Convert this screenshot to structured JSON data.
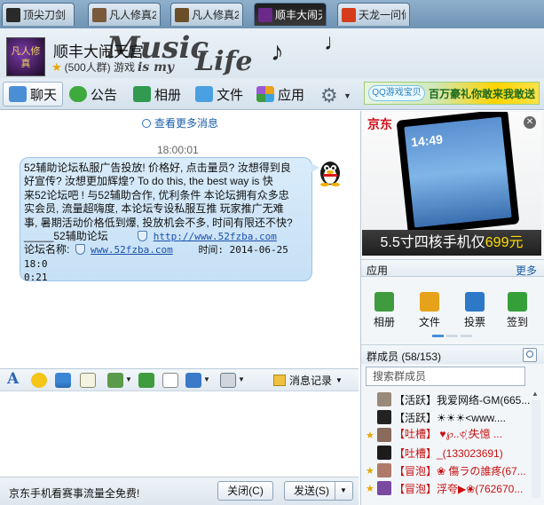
{
  "tabs": [
    {
      "label": "顶尖刀剑",
      "color": "#2a2a2a"
    },
    {
      "label": "凡人修真2",
      "color": "#7a5a3a"
    },
    {
      "label": "凡人修真2",
      "color": "#6b4f2a"
    },
    {
      "label": "顺丰大闹天",
      "color": "#6b2a8a"
    },
    {
      "label": "天龙一问仙",
      "color": "#d43c1c"
    }
  ],
  "header": {
    "avatar_text": "凡人修真",
    "group_name": "顺丰大闹天宫",
    "member_count_text": "(500人群) 游戏",
    "deco_line1": "Music",
    "deco_line2": "is my",
    "deco_line3": "Life"
  },
  "toolbar": {
    "items": [
      {
        "label": "聊天",
        "icon": "chat-icon"
      },
      {
        "label": "公告",
        "icon": "announcement-icon"
      },
      {
        "label": "相册",
        "icon": "album-icon"
      },
      {
        "label": "文件",
        "icon": "file-icon"
      },
      {
        "label": "应用",
        "icon": "apps-icon"
      }
    ],
    "settings_icon": "gear-icon",
    "ad_logo": "QQ游戏宝贝",
    "ad_text": "百万豪礼你敢来我敢送"
  },
  "chat": {
    "more_messages": "查看更多消息",
    "timestamp": "18:00:01",
    "message_lines": [
      "52辅助论坛私服广告投放! 价格好, 点击量员? 汝想得到良",
      "好宣传? 汝想更加辉煌? To do this, the best way is 快",
      "来52论坛吧 ! 与52辅助合作, 优利条件 本论坛拥有众多忠",
      "实会员, 流量超嗨度, 本论坛专设私服互推 玩家推广无难",
      "事, 暑期活动价格低到爆, 投放机会不多, 时间有限还不快?"
    ],
    "forum_prefix": "_____52辅助论坛",
    "forum_link": "http://www.52fzba.com",
    "address_label": "论坛名称:",
    "address_link": "www.52fzba.com",
    "time_label": "时间: 2014-06-25 18:0",
    "time_tail": "0:21"
  },
  "input_toolbar": {
    "history_label": "消息记录"
  },
  "bottom": {
    "promo": "京东手机看赛事流量全免费!",
    "close_label": "关闭(C)",
    "send_label": "发送(S)"
  },
  "right_panel": {
    "jd_logo": "京东",
    "phone_time": "14:49",
    "ad_caption_prefix": "5.5寸四核手机仅",
    "ad_caption_price": "699元",
    "apps_title": "应用",
    "apps_more": "更多",
    "apps": [
      {
        "label": "相册",
        "color": "#3e9b3e"
      },
      {
        "label": "文件",
        "color": "#e7a21c"
      },
      {
        "label": "投票",
        "color": "#2e78c8"
      },
      {
        "label": "签到",
        "color": "#35a03a"
      }
    ],
    "members_title": "群成员 (58/153)",
    "search_placeholder": "搜索群成员",
    "members": [
      {
        "text": "【活跃】我爱网络-GM(665...",
        "color": "#111111",
        "star": false,
        "avatar": "#9a8a7a"
      },
      {
        "text": "【活跃】☀☀☀<www....",
        "color": "#111111",
        "star": false,
        "avatar": "#222222"
      },
      {
        "text": "【吐槽】 ♥℘..৩҉ 失憶 ...",
        "color": "#c81010",
        "star": true,
        "avatar": "#8a6a5a"
      },
      {
        "text": "【吐槽】_(133023691)",
        "color": "#c81010",
        "star": false,
        "avatar": "#1c1c1c"
      },
      {
        "text": "【冒泡】❀ 傷ラの誰疼(67...",
        "color": "#c81010",
        "star": true,
        "avatar": "#b07a6a"
      },
      {
        "text": "【冒泡】浮夸▶❀(762670...",
        "color": "#c81010",
        "star": true,
        "avatar": "#7a4aa0"
      }
    ]
  }
}
